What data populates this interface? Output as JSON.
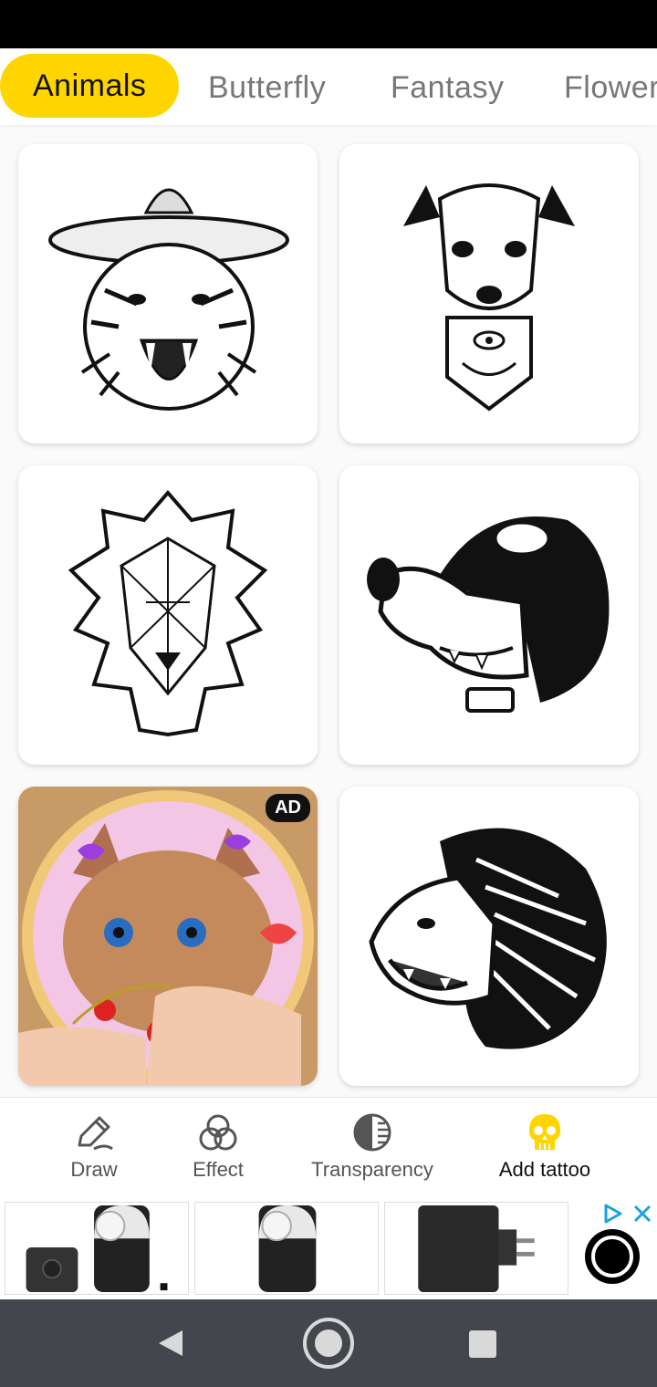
{
  "tabs": [
    "Animals",
    "Butterfly",
    "Fantasy",
    "Flower"
  ],
  "active_tab": 0,
  "cards": [
    {
      "name": "tiger-sombrero-tattoo"
    },
    {
      "name": "dog-tattoo"
    },
    {
      "name": "geometric-lion-tattoo"
    },
    {
      "name": "wolf-helmet-tattoo"
    },
    {
      "name": "cross-stitch-kitten-ad",
      "badge": "AD"
    },
    {
      "name": "tribal-lion-tattoo"
    }
  ],
  "toolbar": {
    "draw": "Draw",
    "effect": "Effect",
    "transparency": "Transparency",
    "add_tattoo": "Add tattoo"
  },
  "colors": {
    "accent": "#ffd500",
    "nav_bar": "#43474d",
    "ad_choice_blue": "#1aa1e0"
  }
}
